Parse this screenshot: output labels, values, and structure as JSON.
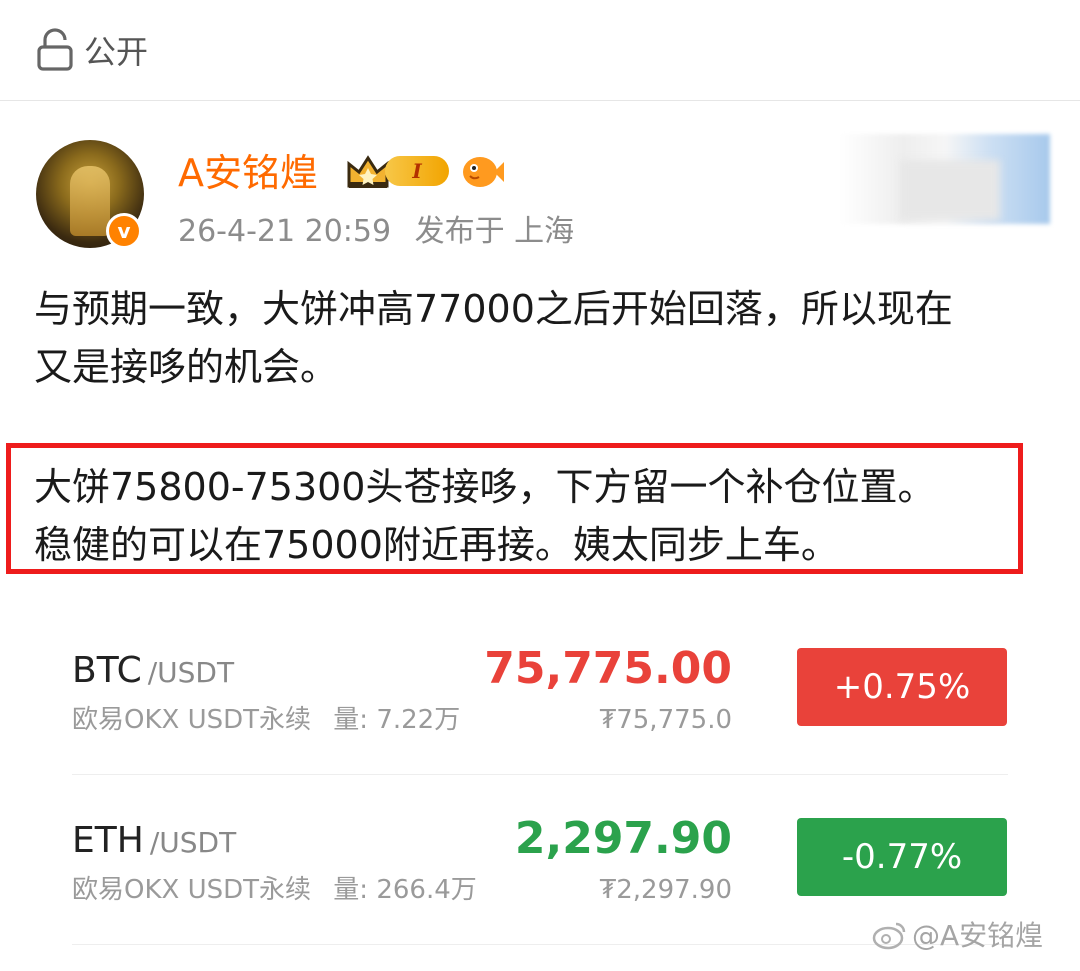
{
  "visibility": {
    "label": "公开",
    "icon": "lock-icon"
  },
  "author": {
    "name": "A安铭煌",
    "level_badge": "I",
    "time": "26-4-21 20:59",
    "location": "发布于 上海",
    "verified_mark": "v",
    "name_color": "#ff6a00"
  },
  "post": {
    "paragraph1_line1": "与预期一致，大饼冲高77000之后开始回落，所以现在",
    "paragraph1_line2": "又是接哆的机会。",
    "highlight_line1": "大饼75800-75300头苍接哆，下方留一个补仓位置。",
    "highlight_line2": "稳健的可以在75000附近再接。姨太同步上车。",
    "highlight_border_color": "#ee1c1c"
  },
  "tickers": [
    {
      "symbol": "BTC",
      "quote": "/USDT",
      "exchange": "欧易OKX USDT永续",
      "volume": "量: 7.22万",
      "price": "75,775.00",
      "price_cny": "₮75,775.0",
      "change": "+0.75%",
      "direction": "up",
      "color": "#e9423a"
    },
    {
      "symbol": "ETH",
      "quote": "/USDT",
      "exchange": "欧易OKX USDT永续",
      "volume": "量: 266.4万",
      "price": "2,297.90",
      "price_cny": "₮2,297.90",
      "change": "-0.77%",
      "direction": "down",
      "color": "#2ba24c"
    }
  ],
  "watermark": {
    "text": "@A安铭煌",
    "icon": "weibo-icon"
  }
}
